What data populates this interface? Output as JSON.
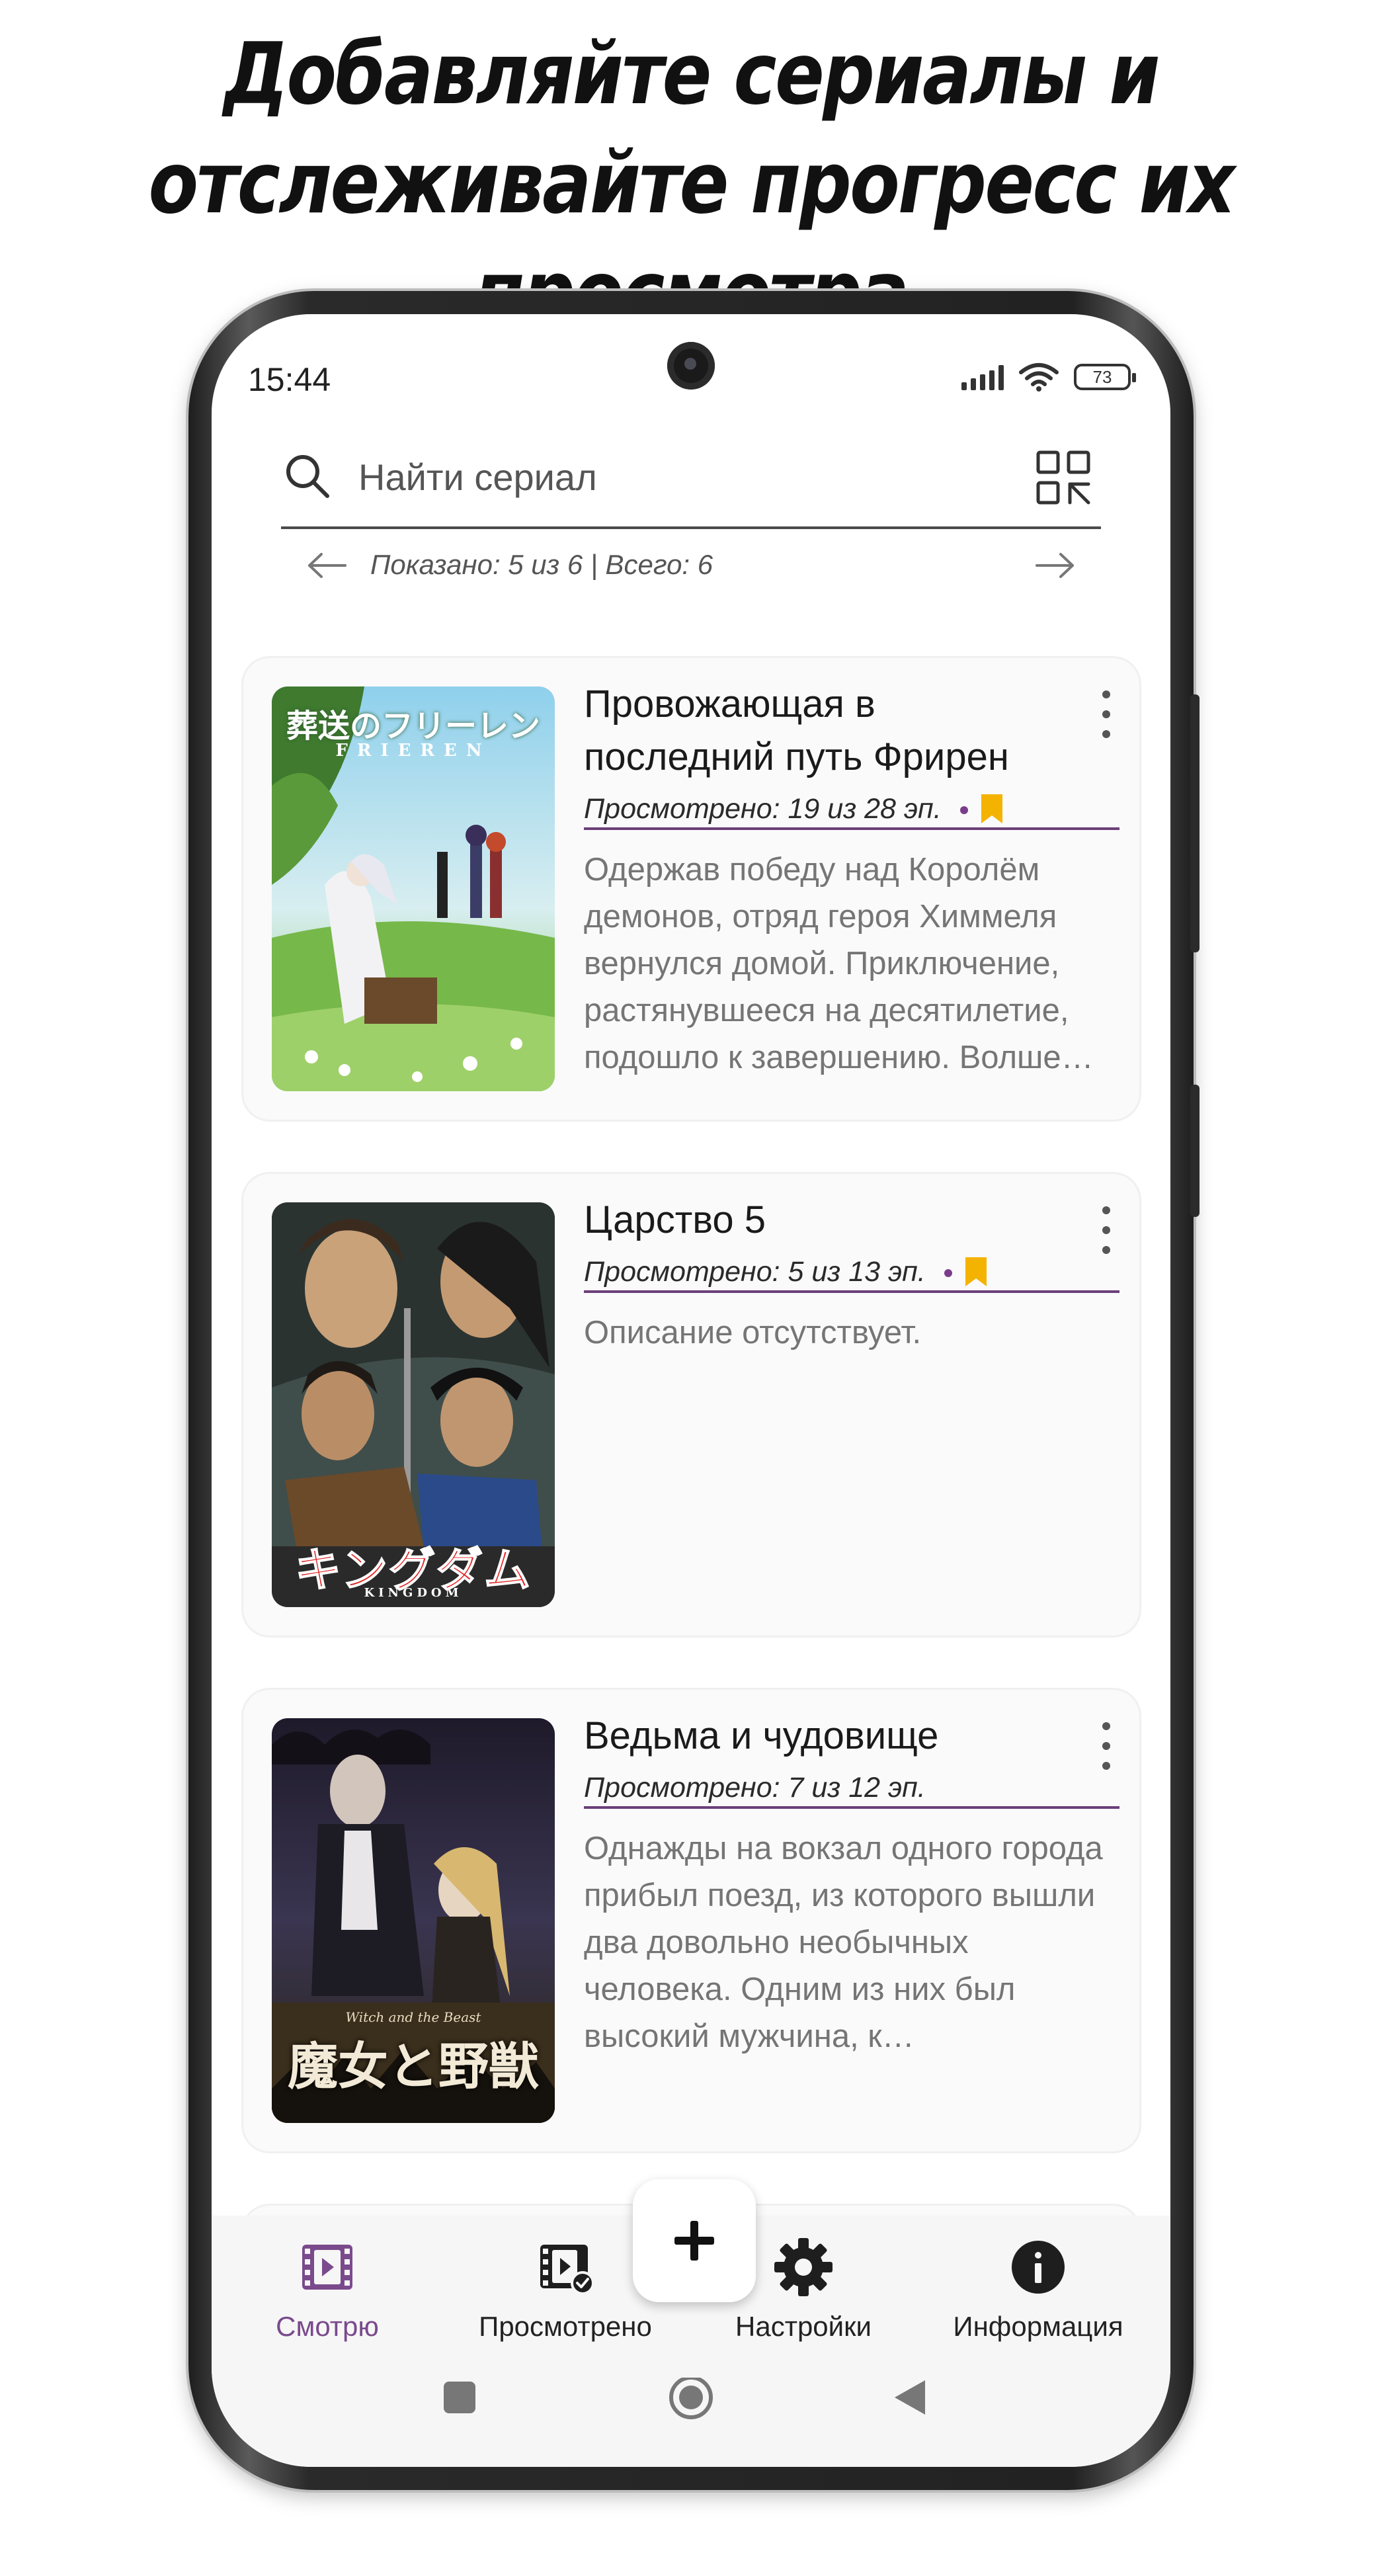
{
  "headline": {
    "line1": "Добавляйте сериалы и",
    "line2": "отслеживайте прогресс их просмотра"
  },
  "status_bar": {
    "time": "15:44",
    "battery": "73"
  },
  "search": {
    "placeholder": "Найти сериал"
  },
  "pager": {
    "text": "Показано: 5 из 6 | Всего: 6"
  },
  "cards": [
    {
      "title": "Провожающая в последний путь Фрирен",
      "progress": "Просмотрено: 19 из 28 эп.",
      "bookmarked": true,
      "description": "Одержав победу над Королём демонов, отряд героя Химмеля вернулся домой. Приключение, растянувшееся на десятилетие, подошло к завершению. Волше…",
      "poster_text_jp": "葬送のフリーレン",
      "poster_text_en": "FRIEREN"
    },
    {
      "title": "Царство 5",
      "progress": "Просмотрено: 5 из 13 эп.",
      "bookmarked": true,
      "description": "Описание отсутствует.",
      "poster_text_jp": "キングダム",
      "poster_text_en": "KINGDOM"
    },
    {
      "title": "Ведьма и чудовище",
      "progress": "Просмотрено: 7 из 12 эп.",
      "bookmarked": false,
      "description": "Однажды на вокзал одного города прибыл поезд, из которого вышли два довольно необычных человека. Одним из них был высокий мужчина, к…",
      "poster_text_jp": "魔女と野獣",
      "poster_text_en": "Witch and the Beast"
    }
  ],
  "bottom_nav": {
    "items": [
      {
        "label": "Смотрю",
        "icon": "film-icon",
        "active": true
      },
      {
        "label": "Просмотрено",
        "icon": "film-check-icon",
        "active": false
      },
      {
        "label": "Настройки",
        "icon": "gear-icon",
        "active": false
      },
      {
        "label": "Информация",
        "icon": "info-icon",
        "active": false
      }
    ]
  },
  "colors": {
    "accent": "#6b3f7a",
    "bookmark": "#f5b301",
    "active_nav": "#7a4a8c",
    "description": "#757575"
  }
}
